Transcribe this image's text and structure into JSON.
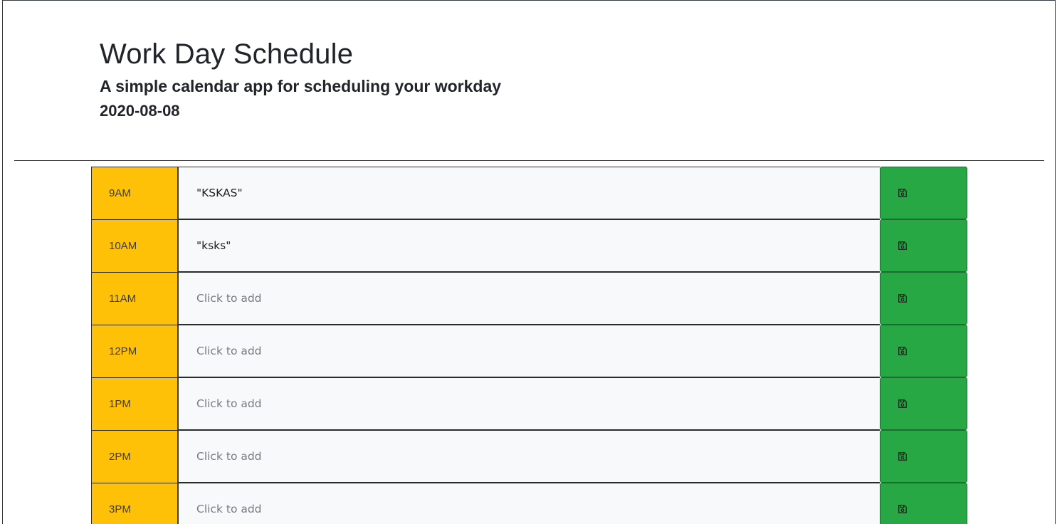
{
  "header": {
    "title": "Work Day Schedule",
    "subtitle": "A simple calendar app for scheduling your workday",
    "date": "2020-08-08"
  },
  "colors": {
    "hour_bg": "#ffc107",
    "description_bg": "#f8f9fa",
    "save_bg": "#28a745"
  },
  "save_icon": "floppy-disk-icon",
  "rows": [
    {
      "hour": "9AM",
      "text": "\"KSKAS\"",
      "placeholder": ""
    },
    {
      "hour": "10AM",
      "text": "\"ksks\"",
      "placeholder": ""
    },
    {
      "hour": "11AM",
      "text": "",
      "placeholder": "Click to add"
    },
    {
      "hour": "12PM",
      "text": "",
      "placeholder": "Click to add"
    },
    {
      "hour": "1PM",
      "text": "",
      "placeholder": "Click to add"
    },
    {
      "hour": "2PM",
      "text": "",
      "placeholder": "Click to add"
    },
    {
      "hour": "3PM",
      "text": "",
      "placeholder": "Click to add"
    }
  ]
}
